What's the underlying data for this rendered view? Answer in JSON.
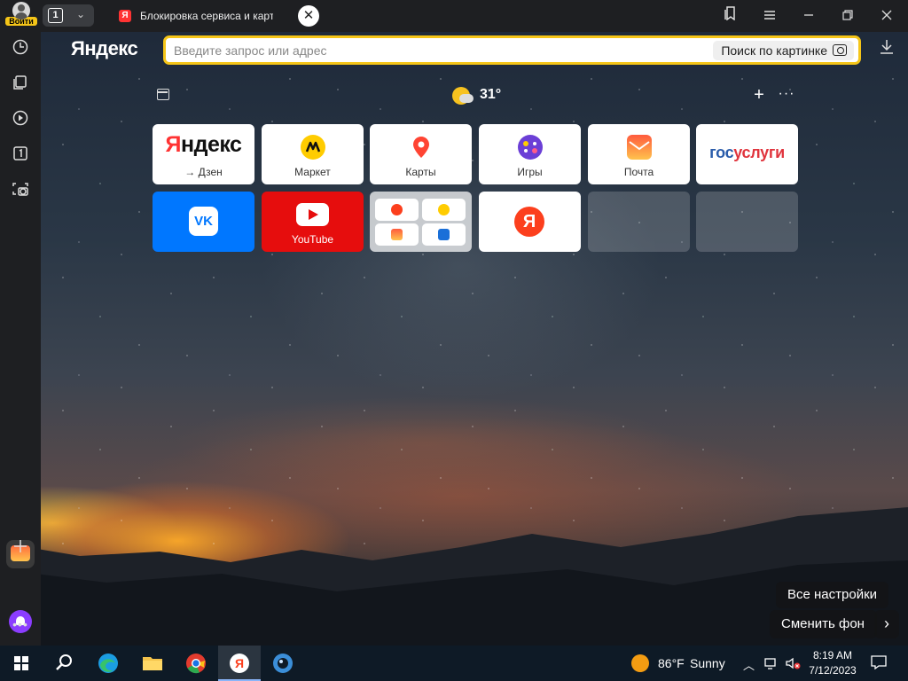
{
  "titlebar": {
    "login_label": "Войти",
    "tab_count": "1",
    "tab": {
      "favicon": "Я",
      "title": "Блокировка сервиса и карт",
      "close": "✕"
    }
  },
  "address_bar": {
    "logo": "Яндекс",
    "placeholder": "Введите запрос или адрес",
    "image_search_label": "Поиск по картинке"
  },
  "newtab": {
    "weather": {
      "temp": "31°"
    },
    "tiles_row1": [
      {
        "name": "yandex-dzen",
        "big_first": "Я",
        "big_rest": "ндекс",
        "label": "→ Дзен"
      },
      {
        "name": "market",
        "label": "Маркет"
      },
      {
        "name": "karty",
        "label": "Карты"
      },
      {
        "name": "igry",
        "label": "Игры"
      },
      {
        "name": "pochta",
        "label": "Почта"
      },
      {
        "name": "gosuslugi",
        "text_a": "гос",
        "text_b": "услуги"
      }
    ],
    "tiles_row2": [
      {
        "name": "vk",
        "text": "VK"
      },
      {
        "name": "youtube",
        "label": "YouTube"
      },
      {
        "name": "group"
      },
      {
        "name": "yandex-browser",
        "text": "Я"
      },
      {
        "name": "empty-1"
      },
      {
        "name": "empty-2"
      }
    ],
    "all_settings": "Все настройки",
    "change_background": "Сменить фон",
    "next_symbol": "›"
  },
  "taskbar": {
    "weather_temp": "86°F",
    "weather_text": "Sunny",
    "time": "8:19 AM",
    "date": "7/12/2023"
  },
  "colors": {
    "accent_yellow": "#f5c518",
    "yandex_red": "#fc3f1d",
    "vk_blue": "#0077ff",
    "youtube_red": "#e60d0d",
    "gosuslugi_blue": "#2a5caa",
    "gosuslugi_red": "#e0343d"
  }
}
